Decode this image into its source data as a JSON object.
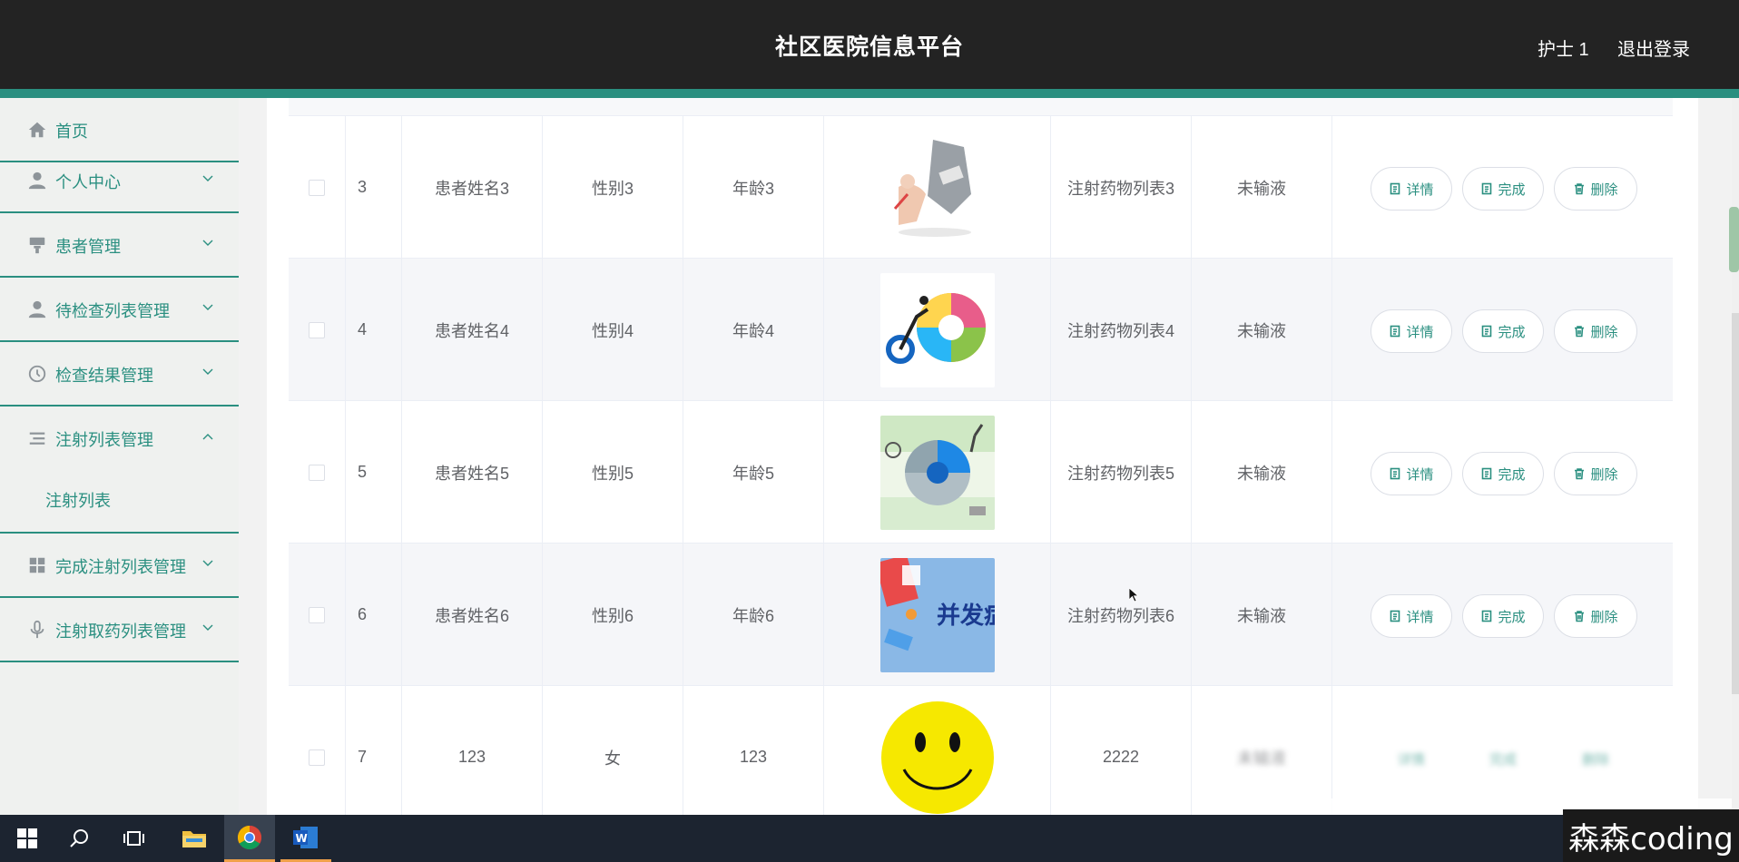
{
  "header": {
    "title": "社区医院信息平台",
    "user": "护士 1",
    "logout": "退出登录"
  },
  "sidebar": {
    "items": [
      {
        "label": "首页",
        "icon": "home-icon"
      },
      {
        "label": "个人中心",
        "icon": "user-icon"
      },
      {
        "label": "患者管理",
        "icon": "stamp-icon"
      },
      {
        "label": "待检查列表管理",
        "icon": "user-icon"
      },
      {
        "label": "检查结果管理",
        "icon": "clock-icon"
      },
      {
        "label": "注射列表管理",
        "icon": "list-icon"
      },
      {
        "label": "完成注射列表管理",
        "icon": "grid-icon"
      },
      {
        "label": "注射取药列表管理",
        "icon": "microphone-icon"
      }
    ],
    "sub_item": "注射列表"
  },
  "table": {
    "rows": [
      {
        "idx": "3",
        "name": "患者姓名3",
        "sex": "性别3",
        "age": "年龄3",
        "image": "health-illustration",
        "drug": "注射药物列表3",
        "status": "未输液"
      },
      {
        "idx": "4",
        "name": "患者姓名4",
        "sex": "性别4",
        "age": "年龄4",
        "image": "nutrition-wheel-illustration",
        "drug": "注射药物列表4",
        "status": "未输液"
      },
      {
        "idx": "5",
        "name": "患者姓名5",
        "sex": "性别5",
        "age": "年龄5",
        "image": "health-cycle-illustration",
        "drug": "注射药物列表5",
        "status": "未输液"
      },
      {
        "idx": "6",
        "name": "患者姓名6",
        "sex": "性别6",
        "age": "年龄6",
        "image": "complication-illustration",
        "image_text": "并发症",
        "drug": "注射药物列表6",
        "status": "未输液"
      },
      {
        "idx": "7",
        "name": "123",
        "sex": "女",
        "age": "123",
        "image": "smiley-face",
        "drug": "2222",
        "status": "未输液"
      }
    ],
    "actions": {
      "detail": "详情",
      "done": "完成",
      "delete": "删除"
    }
  },
  "taskbar": {
    "items": [
      "windows-start-icon",
      "search-icon",
      "task-view-icon",
      "file-explorer-icon",
      "chrome-icon",
      "word-icon"
    ]
  },
  "watermark": "森森coding",
  "colors": {
    "header_bg": "#232323",
    "accent": "#2a8f80",
    "sidebar_bg": "#eff1ef",
    "row_stripe": "#f5f6f9"
  }
}
